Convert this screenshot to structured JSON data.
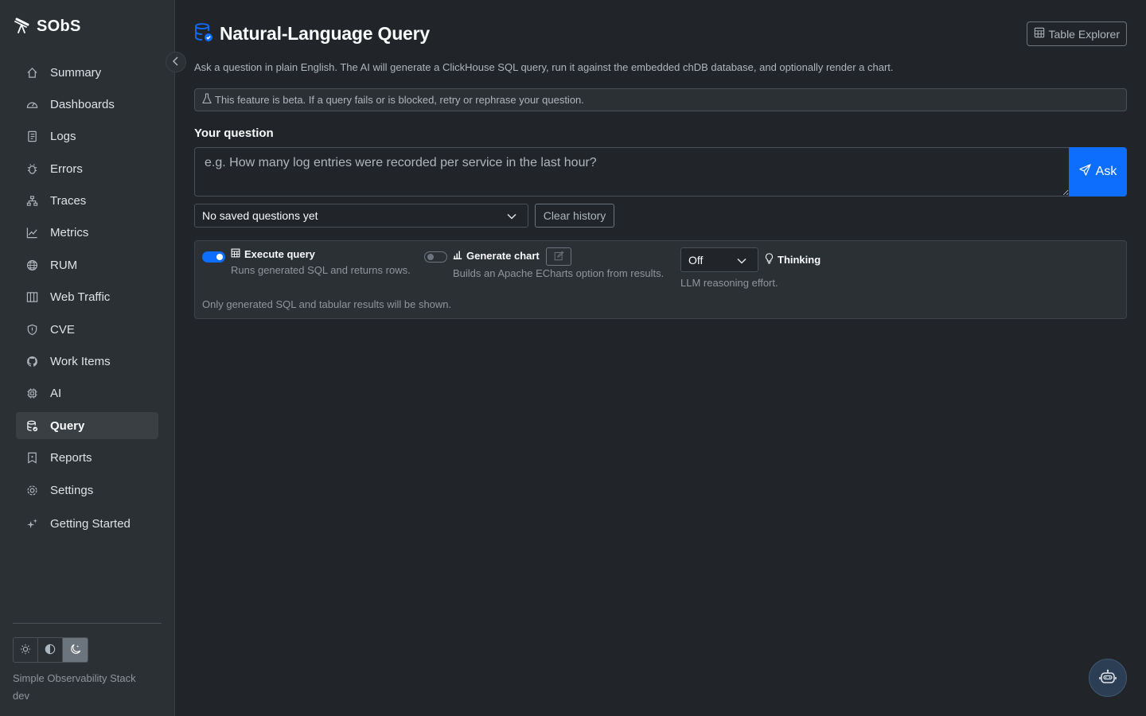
{
  "app": {
    "name": "SObS",
    "footer_line1": "Simple Observability Stack",
    "footer_line2": "dev"
  },
  "sidebar": {
    "items": [
      {
        "label": "Summary",
        "icon": "house-icon",
        "active": false
      },
      {
        "label": "Dashboards",
        "icon": "speedometer-icon",
        "active": false
      },
      {
        "label": "Logs",
        "icon": "journal-icon",
        "active": false
      },
      {
        "label": "Errors",
        "icon": "bug-icon",
        "active": false
      },
      {
        "label": "Traces",
        "icon": "diagram-icon",
        "active": false
      },
      {
        "label": "Metrics",
        "icon": "graph-up-icon",
        "active": false
      },
      {
        "label": "RUM",
        "icon": "globe-icon",
        "active": false
      },
      {
        "label": "Web Traffic",
        "icon": "columns-icon",
        "active": false
      },
      {
        "label": "CVE",
        "icon": "shield-icon",
        "active": false
      },
      {
        "label": "Work Items",
        "icon": "github-icon",
        "active": false
      },
      {
        "label": "AI",
        "icon": "cpu-icon",
        "active": false
      },
      {
        "label": "Query",
        "icon": "database-check-icon",
        "active": true
      },
      {
        "label": "Reports",
        "icon": "bookmark-icon",
        "active": false
      },
      {
        "label": "Settings",
        "icon": "gear-icon",
        "active": false
      }
    ],
    "extra_item": {
      "label": "Getting Started",
      "icon": "stars-icon"
    },
    "theme_modes": [
      "light",
      "auto",
      "dark"
    ],
    "theme_selected": "dark"
  },
  "header": {
    "title": "Natural-Language Query",
    "table_explorer_label": "Table Explorer",
    "subtitle": "Ask a question in plain English. The AI will generate a ClickHouse SQL query, run it against the embedded chDB database, and optionally render a chart.",
    "beta_notice": "This feature is beta. If a query fails or is blocked, retry or rephrase your question."
  },
  "question": {
    "label": "Your question",
    "placeholder": "e.g. How many log entries were recorded per service in the last hour?",
    "value": "",
    "ask_label": "Ask"
  },
  "saved": {
    "selected": "No saved questions yet",
    "clear_label": "Clear history"
  },
  "options": {
    "execute": {
      "title": "Execute query",
      "desc": "Runs generated SQL and returns rows.",
      "enabled": true
    },
    "chart": {
      "title": "Generate chart",
      "desc": "Builds an Apache ECharts option from results.",
      "enabled": false
    },
    "thinking": {
      "title": "Thinking",
      "value": "Off",
      "desc": "LLM reasoning effort."
    },
    "note": "Only generated SQL and tabular results will be shown."
  },
  "colors": {
    "accent": "#0d6efd",
    "background": "#212529",
    "sidebar": "#2b3035"
  }
}
